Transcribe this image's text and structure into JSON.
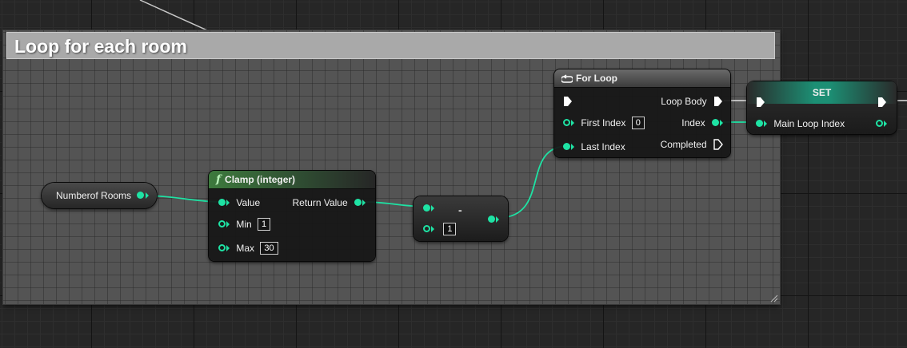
{
  "comment": {
    "title": "Loop for each room"
  },
  "colors": {
    "pin": "#1ee3a4",
    "exec": "#ffffff",
    "comment_title_bg": "#a9a9a9"
  },
  "variable_node": {
    "label": "Numberof Rooms"
  },
  "clamp_node": {
    "title": "Clamp (integer)",
    "icon": "function-icon",
    "inputs": {
      "value": "Value",
      "min": "Min",
      "max": "Max"
    },
    "min_value": "1",
    "max_value": "30",
    "output": "Return Value"
  },
  "subtract_node": {
    "operator": "-",
    "b_value": "1"
  },
  "for_loop_node": {
    "title": "For Loop",
    "icon": "loop-icon",
    "first_index_label": "First Index",
    "first_index_value": "0",
    "last_index_label": "Last Index",
    "loop_body_label": "Loop Body",
    "index_label": "Index",
    "completed_label": "Completed"
  },
  "set_node": {
    "title": "SET",
    "variable": "Main Loop Index"
  }
}
